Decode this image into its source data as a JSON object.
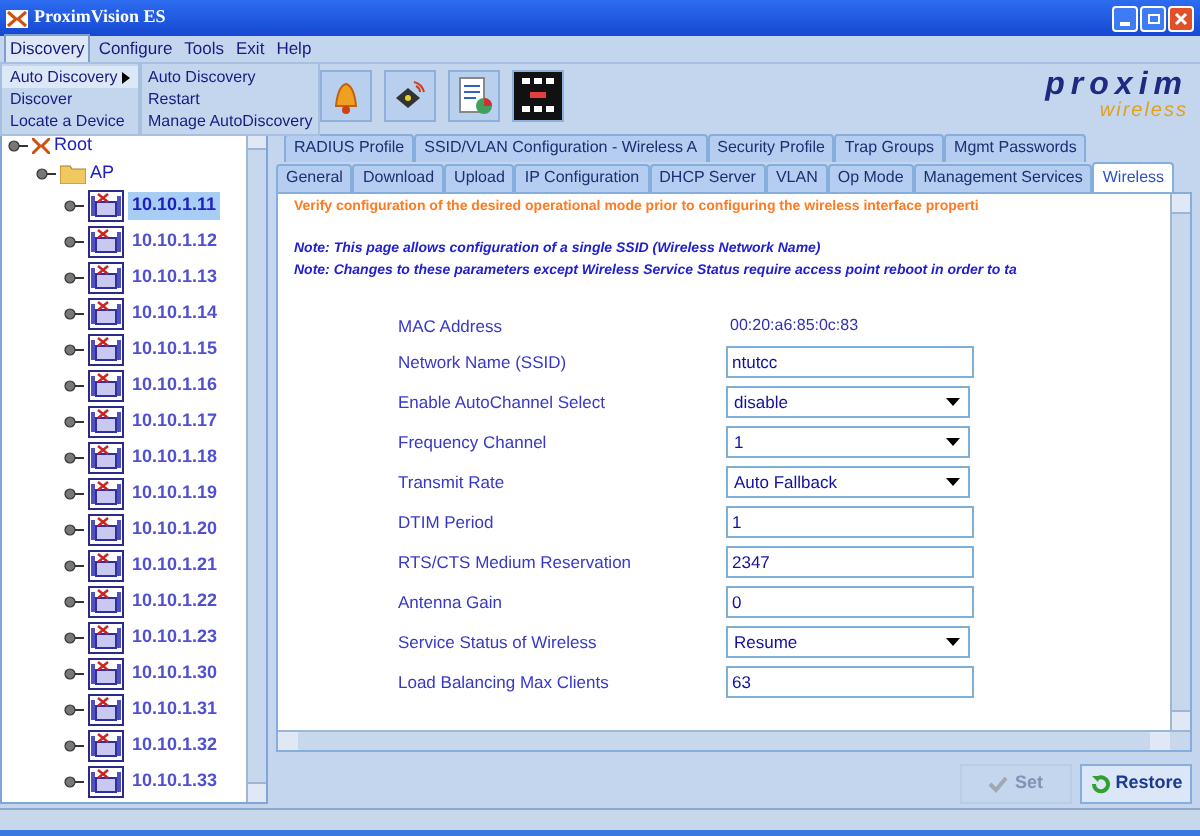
{
  "window": {
    "title": "ProximVision ES"
  },
  "menu_bar": [
    {
      "label": "Discovery",
      "selected": true
    },
    {
      "label": "Configure",
      "selected": false
    },
    {
      "label": "Tools",
      "selected": false
    },
    {
      "label": "Exit",
      "selected": false
    },
    {
      "label": "Help",
      "selected": false
    }
  ],
  "menu": {
    "items": [
      {
        "label": "Auto Discovery",
        "has_submenu": true,
        "selected": true
      },
      {
        "label": "Discover",
        "has_submenu": false,
        "selected": false
      },
      {
        "label": "Locate a Device",
        "has_submenu": false,
        "selected": false
      }
    ]
  },
  "submenu": {
    "items": [
      {
        "label": "Auto Discovery"
      },
      {
        "label": "Restart"
      },
      {
        "label": "Manage AutoDiscovery"
      }
    ]
  },
  "logo": {
    "name": "proxim",
    "tagline": "wireless"
  },
  "tree": {
    "label": "Root",
    "children": [
      {
        "label": "AP",
        "children": [
          {
            "label": "10.10.1.11",
            "selected": true
          },
          {
            "label": "10.10.1.12",
            "selected": false
          },
          {
            "label": "10.10.1.13",
            "selected": false
          },
          {
            "label": "10.10.1.14",
            "selected": false
          },
          {
            "label": "10.10.1.15",
            "selected": false
          },
          {
            "label": "10.10.1.16",
            "selected": false
          },
          {
            "label": "10.10.1.17",
            "selected": false
          },
          {
            "label": "10.10.1.18",
            "selected": false
          },
          {
            "label": "10.10.1.19",
            "selected": false
          },
          {
            "label": "10.10.1.20",
            "selected": false
          },
          {
            "label": "10.10.1.21",
            "selected": false
          },
          {
            "label": "10.10.1.22",
            "selected": false
          },
          {
            "label": "10.10.1.23",
            "selected": false
          },
          {
            "label": "10.10.1.30",
            "selected": false
          },
          {
            "label": "10.10.1.31",
            "selected": false
          },
          {
            "label": "10.10.1.32",
            "selected": false
          },
          {
            "label": "10.10.1.33",
            "selected": false
          }
        ]
      }
    ]
  },
  "tab_rows": [
    [
      {
        "label": "RADIUS Profile",
        "selected": false
      },
      {
        "label": "SSID/VLAN Configuration - Wireless A",
        "selected": false
      },
      {
        "label": "Security Profile",
        "selected": false
      },
      {
        "label": "Trap Groups",
        "selected": false
      },
      {
        "label": "Mgmt Passwords",
        "selected": false
      }
    ],
    [
      {
        "label": "General",
        "selected": false
      },
      {
        "label": "Download",
        "selected": false
      },
      {
        "label": "Upload",
        "selected": false
      },
      {
        "label": "IP Configuration",
        "selected": false
      },
      {
        "label": "DHCP Server",
        "selected": false
      },
      {
        "label": "VLAN",
        "selected": false
      },
      {
        "label": "Op Mode",
        "selected": false
      },
      {
        "label": "Management Services",
        "selected": false
      },
      {
        "label": "Wireless",
        "selected": true
      }
    ]
  ],
  "warning": "Verify configuration of the desired operational mode prior to configuring the wireless interface properti",
  "notes": [
    "Note: This page allows configuration of a single SSID (Wireless Network Name)",
    "Note: Changes to these parameters except Wireless Service Status require access point reboot in order to ta"
  ],
  "fields": [
    {
      "kind": "static",
      "label": "MAC Address",
      "value": "00:20:a6:85:0c:83"
    },
    {
      "kind": "text",
      "label": "Network Name (SSID)",
      "value": "ntutcc"
    },
    {
      "kind": "select",
      "label": "Enable AutoChannel Select",
      "value": "disable"
    },
    {
      "kind": "select",
      "label": "Frequency Channel",
      "value": "1"
    },
    {
      "kind": "select",
      "label": "Transmit Rate",
      "value": "Auto Fallback"
    },
    {
      "kind": "text",
      "label": "DTIM Period",
      "value": "1"
    },
    {
      "kind": "text",
      "label": "RTS/CTS Medium Reservation",
      "value": "2347"
    },
    {
      "kind": "text",
      "label": "Antenna Gain",
      "value": "0"
    },
    {
      "kind": "select",
      "label": "Service Status of Wireless",
      "value": "Resume"
    },
    {
      "kind": "text",
      "label": "Load Balancing Max Clients",
      "value": "63"
    }
  ],
  "buttons": [
    {
      "kind": "set",
      "label": "Set",
      "disabled": true
    },
    {
      "kind": "restore",
      "label": "Restore",
      "disabled": false
    }
  ]
}
